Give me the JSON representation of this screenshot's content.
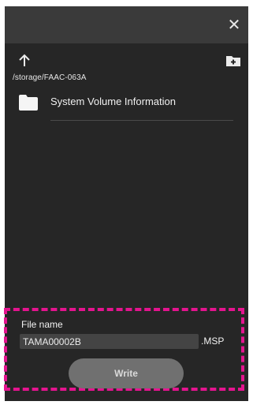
{
  "dialog": {
    "close_icon": "close-icon",
    "up_icon": "arrow-up-icon",
    "new_folder_icon": "new-folder-icon",
    "path": "/storage/FAAC-063A",
    "items": [
      {
        "name": "System Volume Information",
        "icon": "folder-icon"
      }
    ]
  },
  "footer": {
    "filename_label": "File name",
    "filename_value": "TAMA00002B",
    "extension": ".MSP",
    "write_label": "Write"
  },
  "colors": {
    "dialog_bg": "#262626",
    "titlebar_bg": "#3a3a3a",
    "highlight_border": "#e4148f",
    "button_bg": "#707070"
  }
}
